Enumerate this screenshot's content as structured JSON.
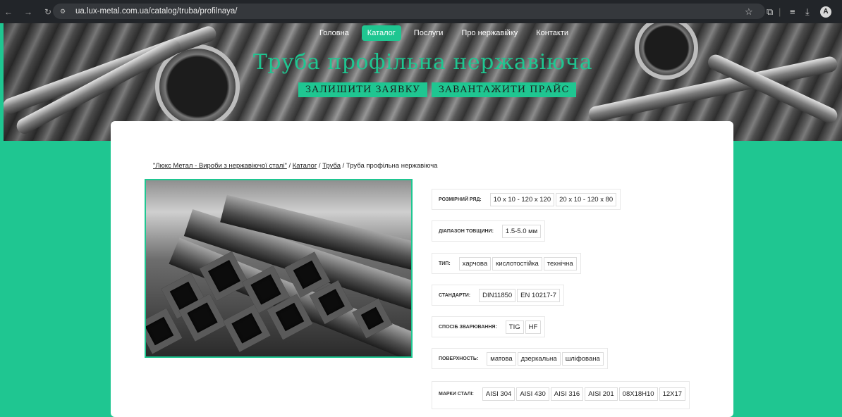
{
  "browser": {
    "url": "ua.lux-metal.com.ua/catalog/truba/profilnaya/",
    "avatar_letter": "A"
  },
  "nav": {
    "items": [
      "Головна",
      "Каталог",
      "Послуги",
      "Про нержавійку",
      "Контакти"
    ],
    "active": "Каталог"
  },
  "hero": {
    "title": "Труба профільна нержавіюча",
    "button_request": "ЗАЛИШИТИ ЗАЯВКУ",
    "button_price": "ЗАВАНТАЖИТИ ПРАЙС"
  },
  "breadcrumb": {
    "home": "\"Люкс Метал - Вироби з нержавіючої сталі\"",
    "sep": " / ",
    "catalog": "Каталог",
    "pipe": "Труба",
    "current": "Труба профільна нержавіюча"
  },
  "specs": [
    {
      "label": "розмірний ряд:",
      "values": [
        "10 x 10 - 120 x 120",
        "20 x 10 - 120 x 80"
      ]
    },
    {
      "label": "діапазон товщини:",
      "values": [
        "1.5-5.0 мм"
      ]
    },
    {
      "label": "тип:",
      "values": [
        "харчова",
        "кислотостійка",
        "технічна"
      ]
    },
    {
      "label": "стандарти:",
      "values": [
        "DIN11850",
        "EN 10217-7"
      ]
    },
    {
      "label": "спосіб зварювання:",
      "values": [
        "TIG",
        "HF"
      ]
    },
    {
      "label": "поверхность:",
      "values": [
        "матова",
        "дзеркальна",
        "шліфована"
      ]
    },
    {
      "label": "марки сталі:",
      "values": [
        "AISI 304",
        "AISI 430",
        "AISI 316",
        "AISI 201",
        "08Х18Н10",
        "12Х17"
      ]
    }
  ],
  "colors": {
    "accent": "#1fc691",
    "browser_bg": "#222529"
  }
}
